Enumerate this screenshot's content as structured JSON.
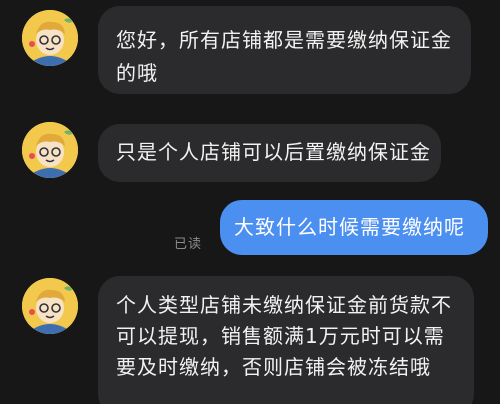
{
  "messages": [
    {
      "from": "them",
      "text": "您好，所有店铺都是需要缴纳保证金的哦"
    },
    {
      "from": "them",
      "text": "只是个人店铺可以后置缴纳保证金"
    },
    {
      "from": "me",
      "text": "大致什么时候需要缴纳呢",
      "status": "已读"
    },
    {
      "from": "them",
      "text": "个人类型店铺未缴纳保证金前货款不可以提现，销售额满1万元时可以需要及时缴纳，否则店铺会被冻结哦"
    }
  ],
  "colors": {
    "background": "#171717",
    "incoming_bubble": "#2b2b2d",
    "outgoing_bubble": "#4b8ff1",
    "read_status": "#8a8a8a"
  }
}
